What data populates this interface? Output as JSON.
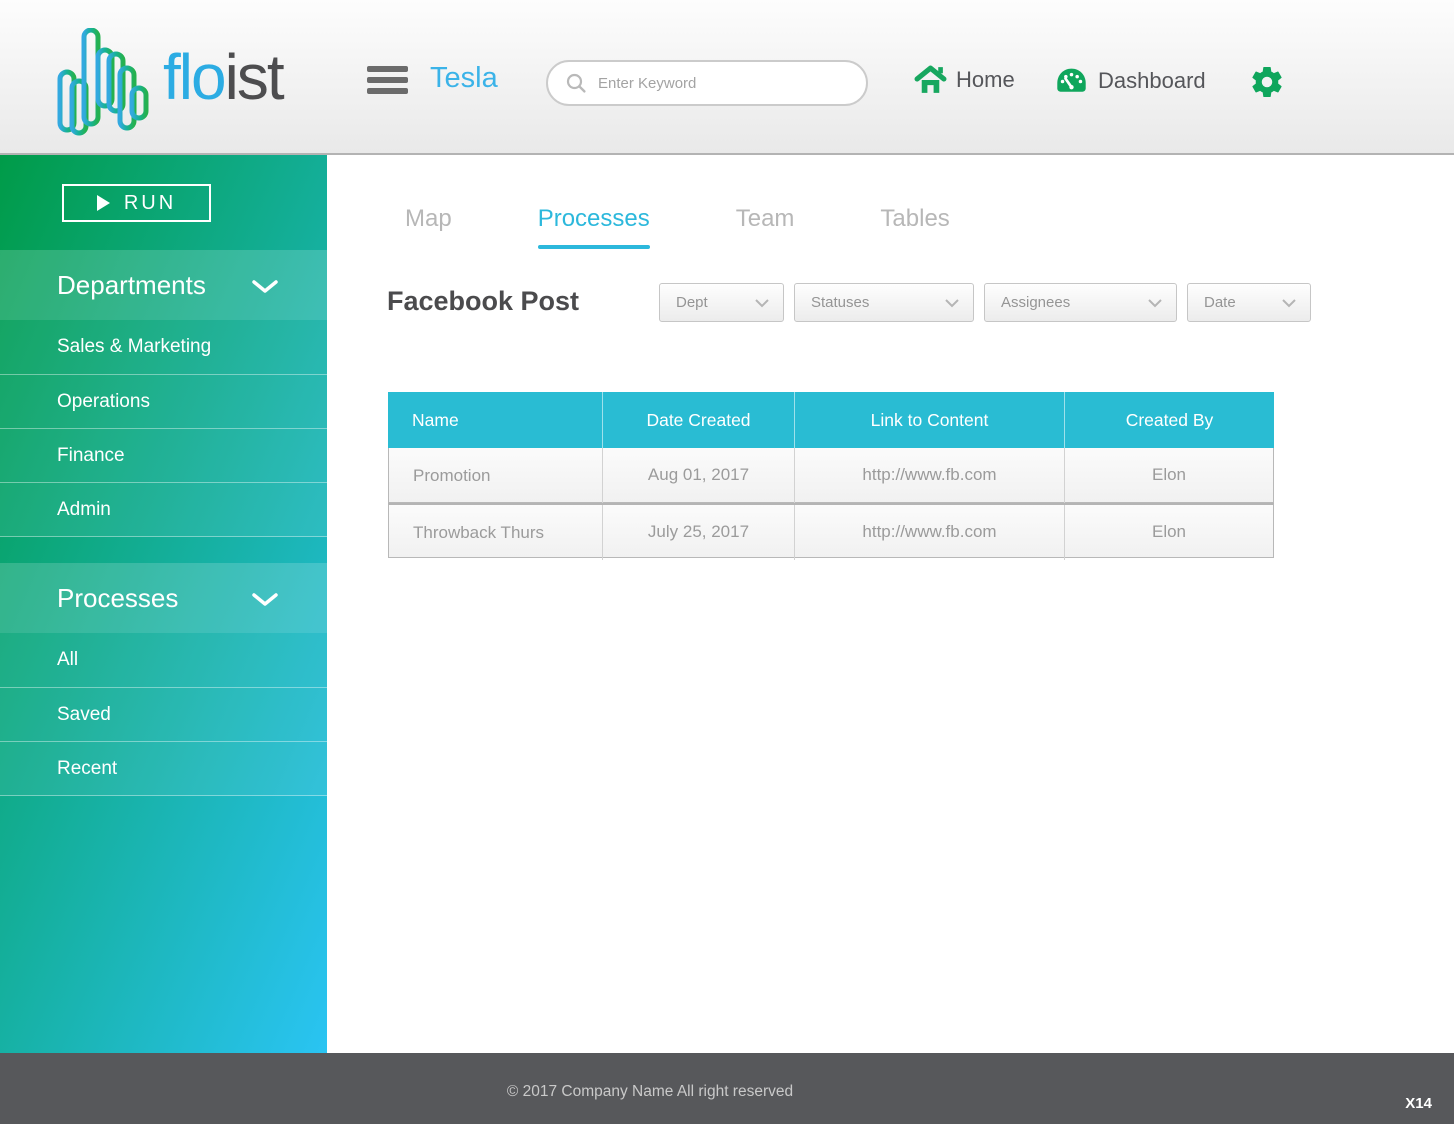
{
  "header": {
    "brand": {
      "logo_text_primary": "flo",
      "logo_text_secondary": "ist"
    },
    "workspace_name": "Tesla",
    "search": {
      "placeholder": "Enter Keyword"
    },
    "nav": {
      "home_label": "Home",
      "dashboard_label": "Dashboard"
    }
  },
  "sidebar": {
    "run_button_label": "RUN",
    "sections": [
      {
        "title": "Departments",
        "items": [
          {
            "label": "Sales & Marketing"
          },
          {
            "label": "Operations"
          },
          {
            "label": "Finance"
          },
          {
            "label": "Admin"
          }
        ]
      },
      {
        "title": "Processes",
        "items": [
          {
            "label": "All"
          },
          {
            "label": "Saved"
          },
          {
            "label": "Recent"
          }
        ]
      }
    ]
  },
  "main": {
    "tabs": [
      {
        "label": "Map",
        "active": false
      },
      {
        "label": "Processes",
        "active": true
      },
      {
        "label": "Team",
        "active": false
      },
      {
        "label": "Tables",
        "active": false
      }
    ],
    "page_title": "Facebook Post",
    "filters": [
      {
        "label": "Dept"
      },
      {
        "label": "Statuses"
      },
      {
        "label": "Assignees"
      },
      {
        "label": "Date"
      }
    ],
    "table": {
      "columns": [
        "Name",
        "Date Created",
        "Link to Content",
        "Created By"
      ],
      "rows": [
        {
          "name": "Promotion",
          "date_created": "Aug 01, 2017",
          "link": "http://www.fb.com",
          "created_by": "Elon"
        },
        {
          "name": "Throwback Thurs",
          "date_created": "July 25, 2017",
          "link": "http://www.fb.com",
          "created_by": "Elon"
        }
      ]
    }
  },
  "footer": {
    "copyright": "© 2017 Company Name  All right reserved",
    "page_ref": "X14"
  },
  "colors": {
    "accent_green": "#12A75C",
    "accent_blue": "#2CACE3",
    "accent_cyan": "#2CB8DC",
    "table_header_teal": "#29BCD3",
    "sidebar_gradient_start": "#009B48",
    "sidebar_gradient_end": "#2AC4F3"
  }
}
